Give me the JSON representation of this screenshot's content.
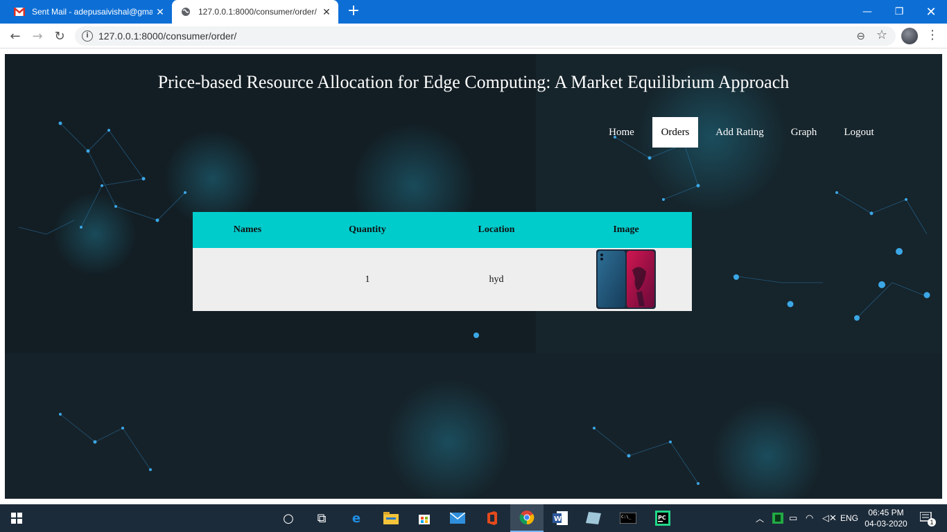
{
  "browser": {
    "tabs": [
      {
        "title": "Sent Mail - adepusaivishal@gmail.com",
        "icon": "gmail-icon"
      },
      {
        "title": "127.0.0.1:8000/consumer/order/",
        "icon": "globe-icon"
      }
    ],
    "url": "127.0.0.1:8000/consumer/order/"
  },
  "page": {
    "title": "Price-based Resource Allocation for Edge Computing: A Market Equilibrium Approach",
    "nav": [
      "Home",
      "Orders",
      "Add Rating",
      "Graph",
      "Logout"
    ],
    "active_nav": "Orders",
    "table": {
      "headers": [
        "Names",
        "Quantity",
        "Location",
        "Image"
      ],
      "rows": [
        {
          "name": "",
          "quantity": "1",
          "location": "hyd",
          "image": "phone-image"
        }
      ]
    },
    "colors": {
      "table_header": "#00cccc",
      "background": "#142027"
    }
  },
  "taskbar": {
    "language": "ENG",
    "time": "06:45 PM",
    "date": "04-03-2020",
    "notifications": "1"
  }
}
